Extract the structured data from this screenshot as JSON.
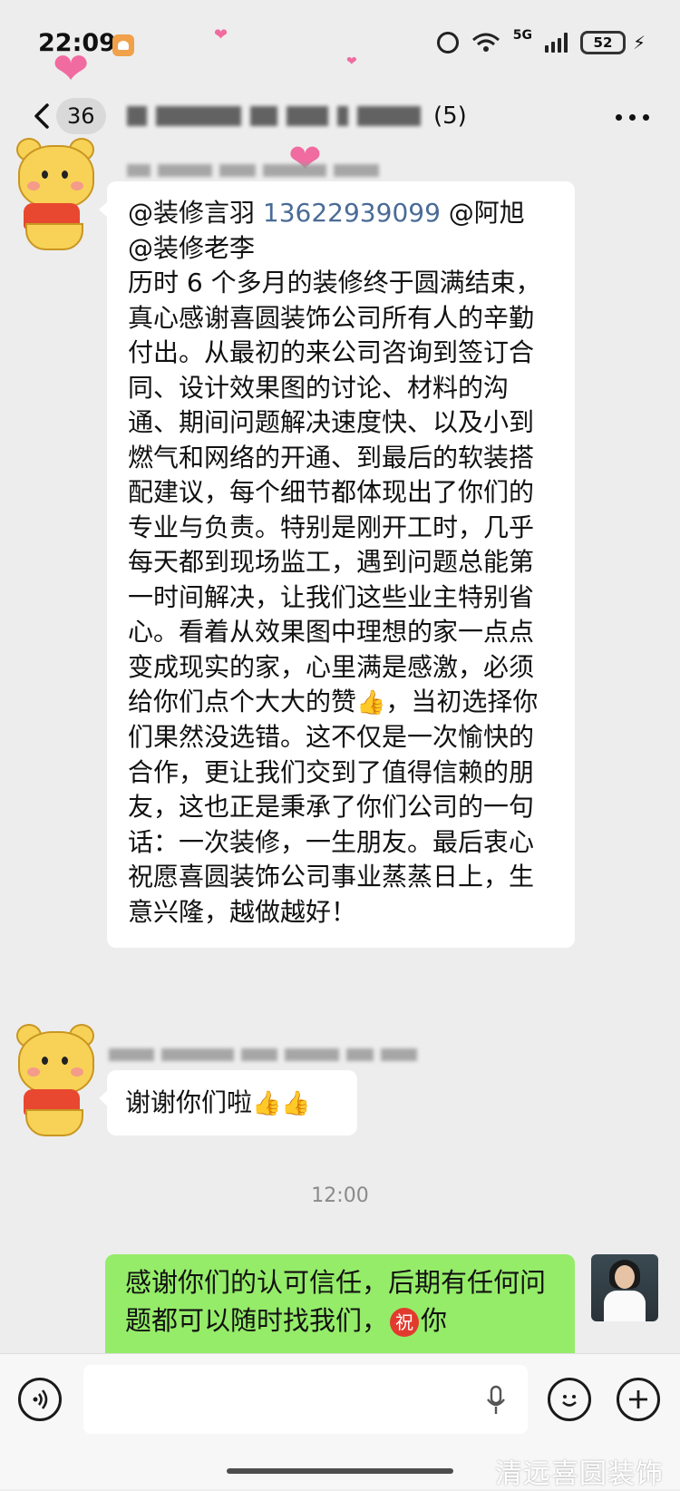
{
  "status_bar": {
    "time": "22:09",
    "network": "5G",
    "battery": "52"
  },
  "nav": {
    "unread_count": "36",
    "member_count": "(5)"
  },
  "messages": [
    {
      "mentions": [
        "@装修言羽",
        "13622939099",
        "@阿旭",
        "@装修老李"
      ],
      "body": " 历时 6 个多月的装修终于圆满结束，真心感谢喜圆装饰公司所有人的辛勤付出。从最初的来公司咨询到签订合同、设计效果图的讨论、材料的沟通、期间问题解决速度快、以及小到燃气和网络的开通、到最后的软装搭配建议，每个细节都体现出了你们的专业与负责。特别是刚开工时，几乎每天都到现场监工，遇到问题总能第一时间解决，让我们这些业主特别省心。看着从效果图中理想的家一点点变成现实的家，心里满是感激，必须给你们点个大大的赞",
      "body_after_emoji": "，当初选择你们果然没选错。这不仅是一次愉快的合作，更让我们交到了值得信赖的朋友，这也正是秉承了你们公司的一句话：一次装修，一生朋友。最后衷心祝愿喜圆装饰公司事业蒸蒸日上，生意兴隆，越做越好！"
    },
    {
      "text": "谢谢你们啦"
    }
  ],
  "timestamp": "12:00",
  "outgoing": {
    "text_before": "感谢你们的认可信任，后期有任何问题都可以随时找我们，",
    "bless_char": "祝",
    "text_after": "你"
  },
  "watermark": "清远喜圆装饰",
  "icons": {
    "thumbs": "thumbs-up-emoji",
    "back": "chevron-left-icon",
    "more": "more-icon",
    "voice": "voice-icon",
    "mic": "mic-icon",
    "emoji": "emoji-icon",
    "plus": "plus-icon"
  },
  "colors": {
    "outgoing_bubble": "#95ec69",
    "background": "#ededed",
    "mention_phone": "#4a6b96"
  }
}
